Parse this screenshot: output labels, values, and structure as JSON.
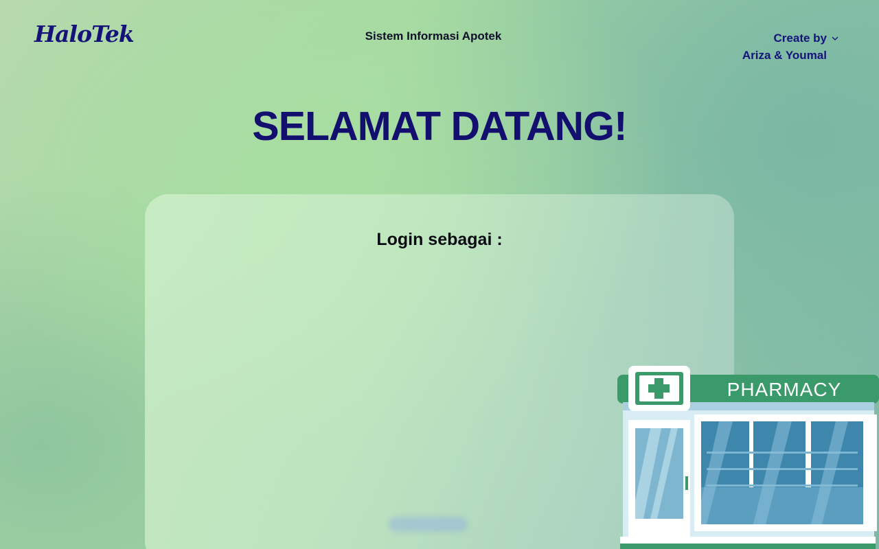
{
  "header": {
    "logo": "HaloTek",
    "subtitle": "Sistem Informasi Apotek",
    "creator_label": "Create by",
    "creator_names": "Ariza & Youmal"
  },
  "main": {
    "welcome": "SELAMAT DATANG!",
    "login_label": "Login sebagai :"
  },
  "illustration": {
    "sign_text": "PHARMACY"
  },
  "colors": {
    "brand": "#15137a",
    "pharmacy_green": "#3a9a6a",
    "glass_blue": "#4f8fb3"
  }
}
